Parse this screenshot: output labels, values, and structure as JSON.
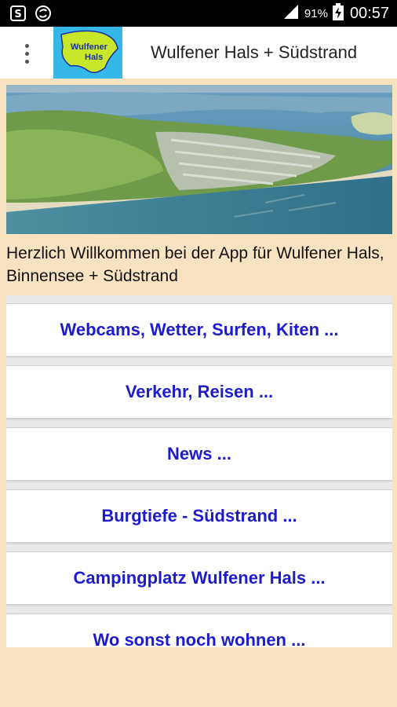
{
  "status_bar": {
    "battery_percent": "91%",
    "time": "00:57",
    "icons": [
      "notification-s-icon",
      "sync-icon",
      "signal-icon",
      "battery-charging-icon"
    ]
  },
  "app_bar": {
    "title": "Wulfener Hals + Südstrand",
    "logo_line1": "Wulfener",
    "logo_line2": "Hals",
    "menu_icon": "overflow-menu-icon"
  },
  "welcome_text": "Herzlich Willkommen bei der App für Wulfener Hals, Binnensee + Südstrand",
  "menu_items": [
    {
      "label": "Webcams, Wetter, Surfen, Kiten ..."
    },
    {
      "label": "Verkehr, Reisen ..."
    },
    {
      "label": "News ..."
    },
    {
      "label": "Burgtiefe - Südstrand ..."
    },
    {
      "label": "Campingplatz Wulfener Hals ..."
    },
    {
      "label": "Wo sonst noch wohnen ..."
    }
  ],
  "colors": {
    "background": "#f7e3c0",
    "link": "#1c1ccc",
    "status_bar": "#000000",
    "logo_bg": "#35b7e8",
    "logo_land": "#c8e62a"
  }
}
